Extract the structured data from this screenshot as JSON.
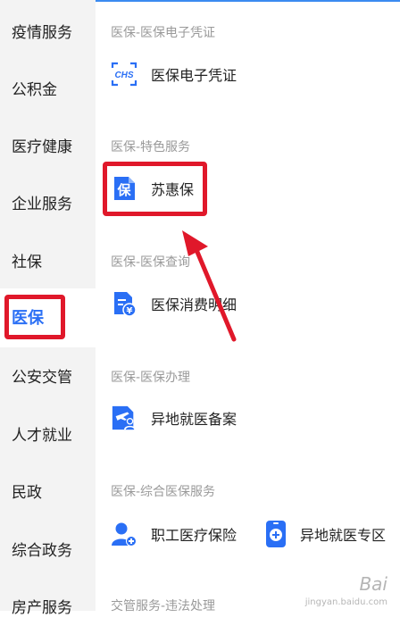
{
  "sidebar": {
    "items": [
      {
        "label": "疫情服务"
      },
      {
        "label": "公积金"
      },
      {
        "label": "医疗健康"
      },
      {
        "label": "企业服务"
      },
      {
        "label": "社保"
      },
      {
        "label": "医保",
        "active": true
      },
      {
        "label": "公安交管"
      },
      {
        "label": "人才就业"
      },
      {
        "label": "民政"
      },
      {
        "label": "综合政务"
      },
      {
        "label": "房产服务"
      }
    ]
  },
  "sections": [
    {
      "title": "医保-医保电子凭证",
      "services": [
        {
          "label": "医保电子凭证",
          "icon": "chs-icon"
        }
      ]
    },
    {
      "title": "医保-特色服务",
      "services": [
        {
          "label": "苏惠保",
          "icon": "bao-icon"
        }
      ]
    },
    {
      "title": "医保-医保查询",
      "services": [
        {
          "label": "医保消费明细",
          "icon": "yuan-doc-icon"
        }
      ]
    },
    {
      "title": "医保-医保办理",
      "services": [
        {
          "label": "异地就医备案",
          "icon": "plane-person-icon"
        }
      ]
    },
    {
      "title": "医保-综合医保服务",
      "services": [
        {
          "label": "职工医疗保险",
          "icon": "person-shield-icon"
        },
        {
          "label": "异地就医专区",
          "icon": "phone-plus-icon"
        }
      ]
    },
    {
      "title": "交管服务-违法处理",
      "services": []
    }
  ],
  "icon_text": {
    "chs": "CHS",
    "bao": "保",
    "yuan": "¥"
  },
  "watermark": {
    "text": "Bai",
    "sub": "jingyan.baidu.com"
  },
  "colors": {
    "accent": "#2a6ff5",
    "annotation": "#e0182a",
    "sidebar_bg": "#f3f3f3"
  }
}
